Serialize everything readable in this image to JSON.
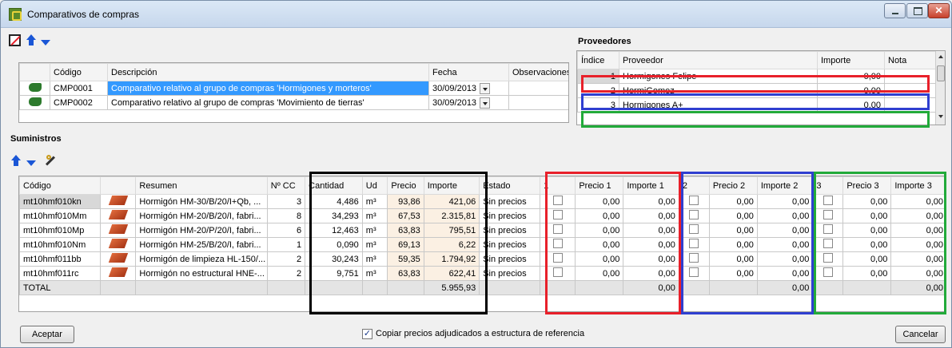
{
  "window": {
    "title": "Comparativos de compras"
  },
  "icons": [
    "delete-icon",
    "arrow-up-icon",
    "arrow-down-icon",
    "tool-icon",
    "boot-icon",
    "brick-icon"
  ],
  "comparativos": {
    "headers": [
      "Código",
      "Descripción",
      "Fecha",
      "Observaciones"
    ],
    "rows": [
      {
        "codigo": "CMP0001",
        "descripcion": "Comparativo relativo al grupo de compras 'Hormigones y morteros'",
        "fecha": "30/09/2013",
        "obs": ""
      },
      {
        "codigo": "CMP0002",
        "descripcion": "Comparativo relativo al grupo de compras 'Movimiento de tierras'",
        "fecha": "30/09/2013",
        "obs": ""
      }
    ]
  },
  "proveedores": {
    "title": "Proveedores",
    "headers": [
      "Índice",
      "Proveedor",
      "Importe",
      "Nota"
    ],
    "rows": [
      {
        "indice": "1",
        "nombre": "Hormigones Felipe",
        "importe": "0,00",
        "nota": ""
      },
      {
        "indice": "2",
        "nombre": "HormiGomez",
        "importe": "0,00",
        "nota": ""
      },
      {
        "indice": "3",
        "nombre": "Hormigones A+",
        "importe": "0,00",
        "nota": ""
      }
    ]
  },
  "suministros": {
    "title": "Suministros",
    "headers": [
      "Código",
      "",
      "Resumen",
      "Nº CC",
      "Cantidad",
      "Ud",
      "Precio",
      "Importe",
      "Estado",
      "1",
      "Precio 1",
      "Importe 1",
      "2",
      "Precio 2",
      "Importe 2",
      "3",
      "Precio 3",
      "Importe 3"
    ],
    "rows": [
      {
        "codigo": "mt10hmf010kn",
        "resumen": "Hormigón HM-30/B/20/I+Qb, ...",
        "ncc": "3",
        "cantidad": "4,486",
        "ud": "m³",
        "precio": "93,86",
        "importe": "421,06",
        "estado": "Sin precios",
        "p1": "0,00",
        "i1": "0,00",
        "p2": "0,00",
        "i2": "0,00",
        "p3": "0,00",
        "i3": "0,00"
      },
      {
        "codigo": "mt10hmf010Mm",
        "resumen": "Hormigón HM-20/B/20/I, fabri...",
        "ncc": "8",
        "cantidad": "34,293",
        "ud": "m³",
        "precio": "67,53",
        "importe": "2.315,81",
        "estado": "Sin precios",
        "p1": "0,00",
        "i1": "0,00",
        "p2": "0,00",
        "i2": "0,00",
        "p3": "0,00",
        "i3": "0,00"
      },
      {
        "codigo": "mt10hmf010Mp",
        "resumen": "Hormigón HM-20/P/20/I, fabri...",
        "ncc": "6",
        "cantidad": "12,463",
        "ud": "m³",
        "precio": "63,83",
        "importe": "795,51",
        "estado": "Sin precios",
        "p1": "0,00",
        "i1": "0,00",
        "p2": "0,00",
        "i2": "0,00",
        "p3": "0,00",
        "i3": "0,00"
      },
      {
        "codigo": "mt10hmf010Nm",
        "resumen": "Hormigón HM-25/B/20/I, fabri...",
        "ncc": "1",
        "cantidad": "0,090",
        "ud": "m³",
        "precio": "69,13",
        "importe": "6,22",
        "estado": "Sin precios",
        "p1": "0,00",
        "i1": "0,00",
        "p2": "0,00",
        "i2": "0,00",
        "p3": "0,00",
        "i3": "0,00"
      },
      {
        "codigo": "mt10hmf011bb",
        "resumen": "Hormigón de limpieza HL-150/...",
        "ncc": "2",
        "cantidad": "30,243",
        "ud": "m³",
        "precio": "59,35",
        "importe": "1.794,92",
        "estado": "Sin precios",
        "p1": "0,00",
        "i1": "0,00",
        "p2": "0,00",
        "i2": "0,00",
        "p3": "0,00",
        "i3": "0,00"
      },
      {
        "codigo": "mt10hmf011rc",
        "resumen": "Hormigón no estructural HNE-...",
        "ncc": "2",
        "cantidad": "9,751",
        "ud": "m³",
        "precio": "63,83",
        "importe": "622,41",
        "estado": "Sin precios",
        "p1": "0,00",
        "i1": "0,00",
        "p2": "0,00",
        "i2": "0,00",
        "p3": "0,00",
        "i3": "0,00"
      }
    ],
    "total": {
      "label": "TOTAL",
      "importe": "5.955,93",
      "i1": "0,00",
      "i2": "0,00",
      "i3": "0,00"
    }
  },
  "footer": {
    "aceptar": "Aceptar",
    "checkbox_label": "Copiar precios adjudicados a estructura de referencia",
    "cancelar": "Cancelar"
  },
  "colors": {
    "red": "#e8202a",
    "blue": "#2f3fd0",
    "green": "#22aa3a",
    "black": "#000000"
  }
}
